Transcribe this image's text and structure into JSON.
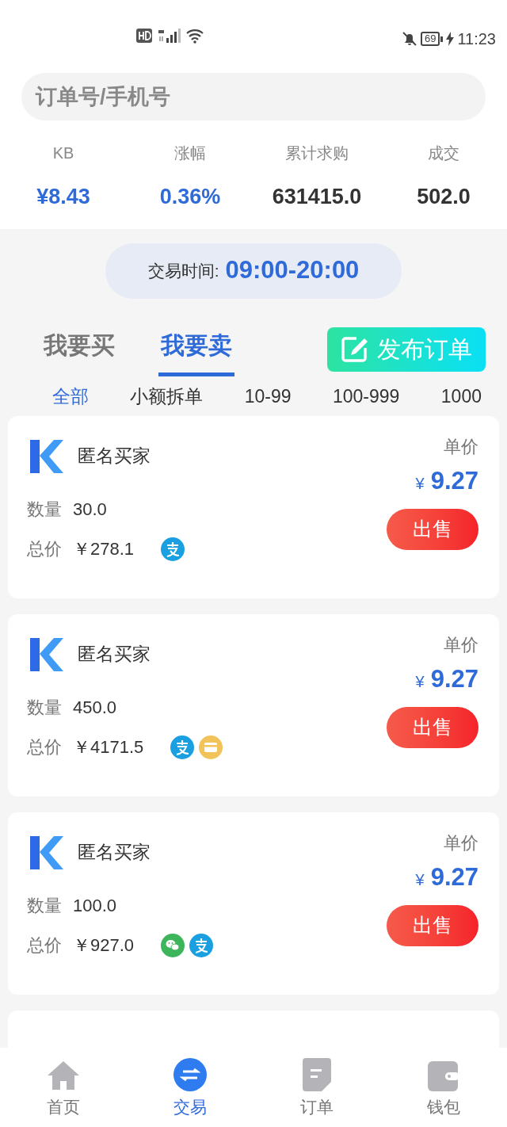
{
  "status_bar": {
    "battery": "69",
    "time": "11:23"
  },
  "search": {
    "placeholder": "订单号/手机号"
  },
  "stats": [
    {
      "label": "KB",
      "value": "¥8.43",
      "highlight": true
    },
    {
      "label": "涨幅",
      "value": "0.36%",
      "highlight": true
    },
    {
      "label": "累计求购",
      "value": "631415.0",
      "highlight": false
    },
    {
      "label": "成交",
      "value": "502.0",
      "highlight": false
    }
  ],
  "trading_hours": {
    "label": "交易时间:",
    "value": "09:00-20:00"
  },
  "tabs": [
    {
      "label": "我要买",
      "selected": false
    },
    {
      "label": "我要卖",
      "selected": true
    }
  ],
  "publish_button": "发布订单",
  "filters": [
    {
      "label": "全部",
      "selected": true
    },
    {
      "label": "小额拆单",
      "selected": false
    },
    {
      "label": "10-99",
      "selected": false
    },
    {
      "label": "100-999",
      "selected": false
    },
    {
      "label": "1000",
      "selected": false
    }
  ],
  "orders": [
    {
      "name": "匿名买家",
      "quantity_label": "数量",
      "quantity": "30.0",
      "total_label": "总价",
      "total": "￥278.1",
      "payments": [
        {
          "kind": "alipay"
        }
      ],
      "price_label": "单价",
      "currency": "¥",
      "price": "9.27",
      "action": "出售"
    },
    {
      "name": "匿名买家",
      "quantity_label": "数量",
      "quantity": "450.0",
      "total_label": "总价",
      "total": "￥4171.5",
      "payments": [
        {
          "kind": "alipay"
        },
        {
          "kind": "card"
        }
      ],
      "price_label": "单价",
      "currency": "¥",
      "price": "9.27",
      "action": "出售"
    },
    {
      "name": "匿名买家",
      "quantity_label": "数量",
      "quantity": "100.0",
      "total_label": "总价",
      "total": "￥927.0",
      "payments": [
        {
          "kind": "wechat"
        },
        {
          "kind": "alipay"
        }
      ],
      "price_label": "单价",
      "currency": "¥",
      "price": "9.27",
      "action": "出售"
    }
  ],
  "bottom_nav": [
    {
      "label": "首页",
      "kind": "home",
      "selected": false
    },
    {
      "label": "交易",
      "kind": "trade",
      "selected": true
    },
    {
      "label": "订单",
      "kind": "orders",
      "selected": false
    },
    {
      "label": "钱包",
      "kind": "wallet",
      "selected": false
    }
  ]
}
